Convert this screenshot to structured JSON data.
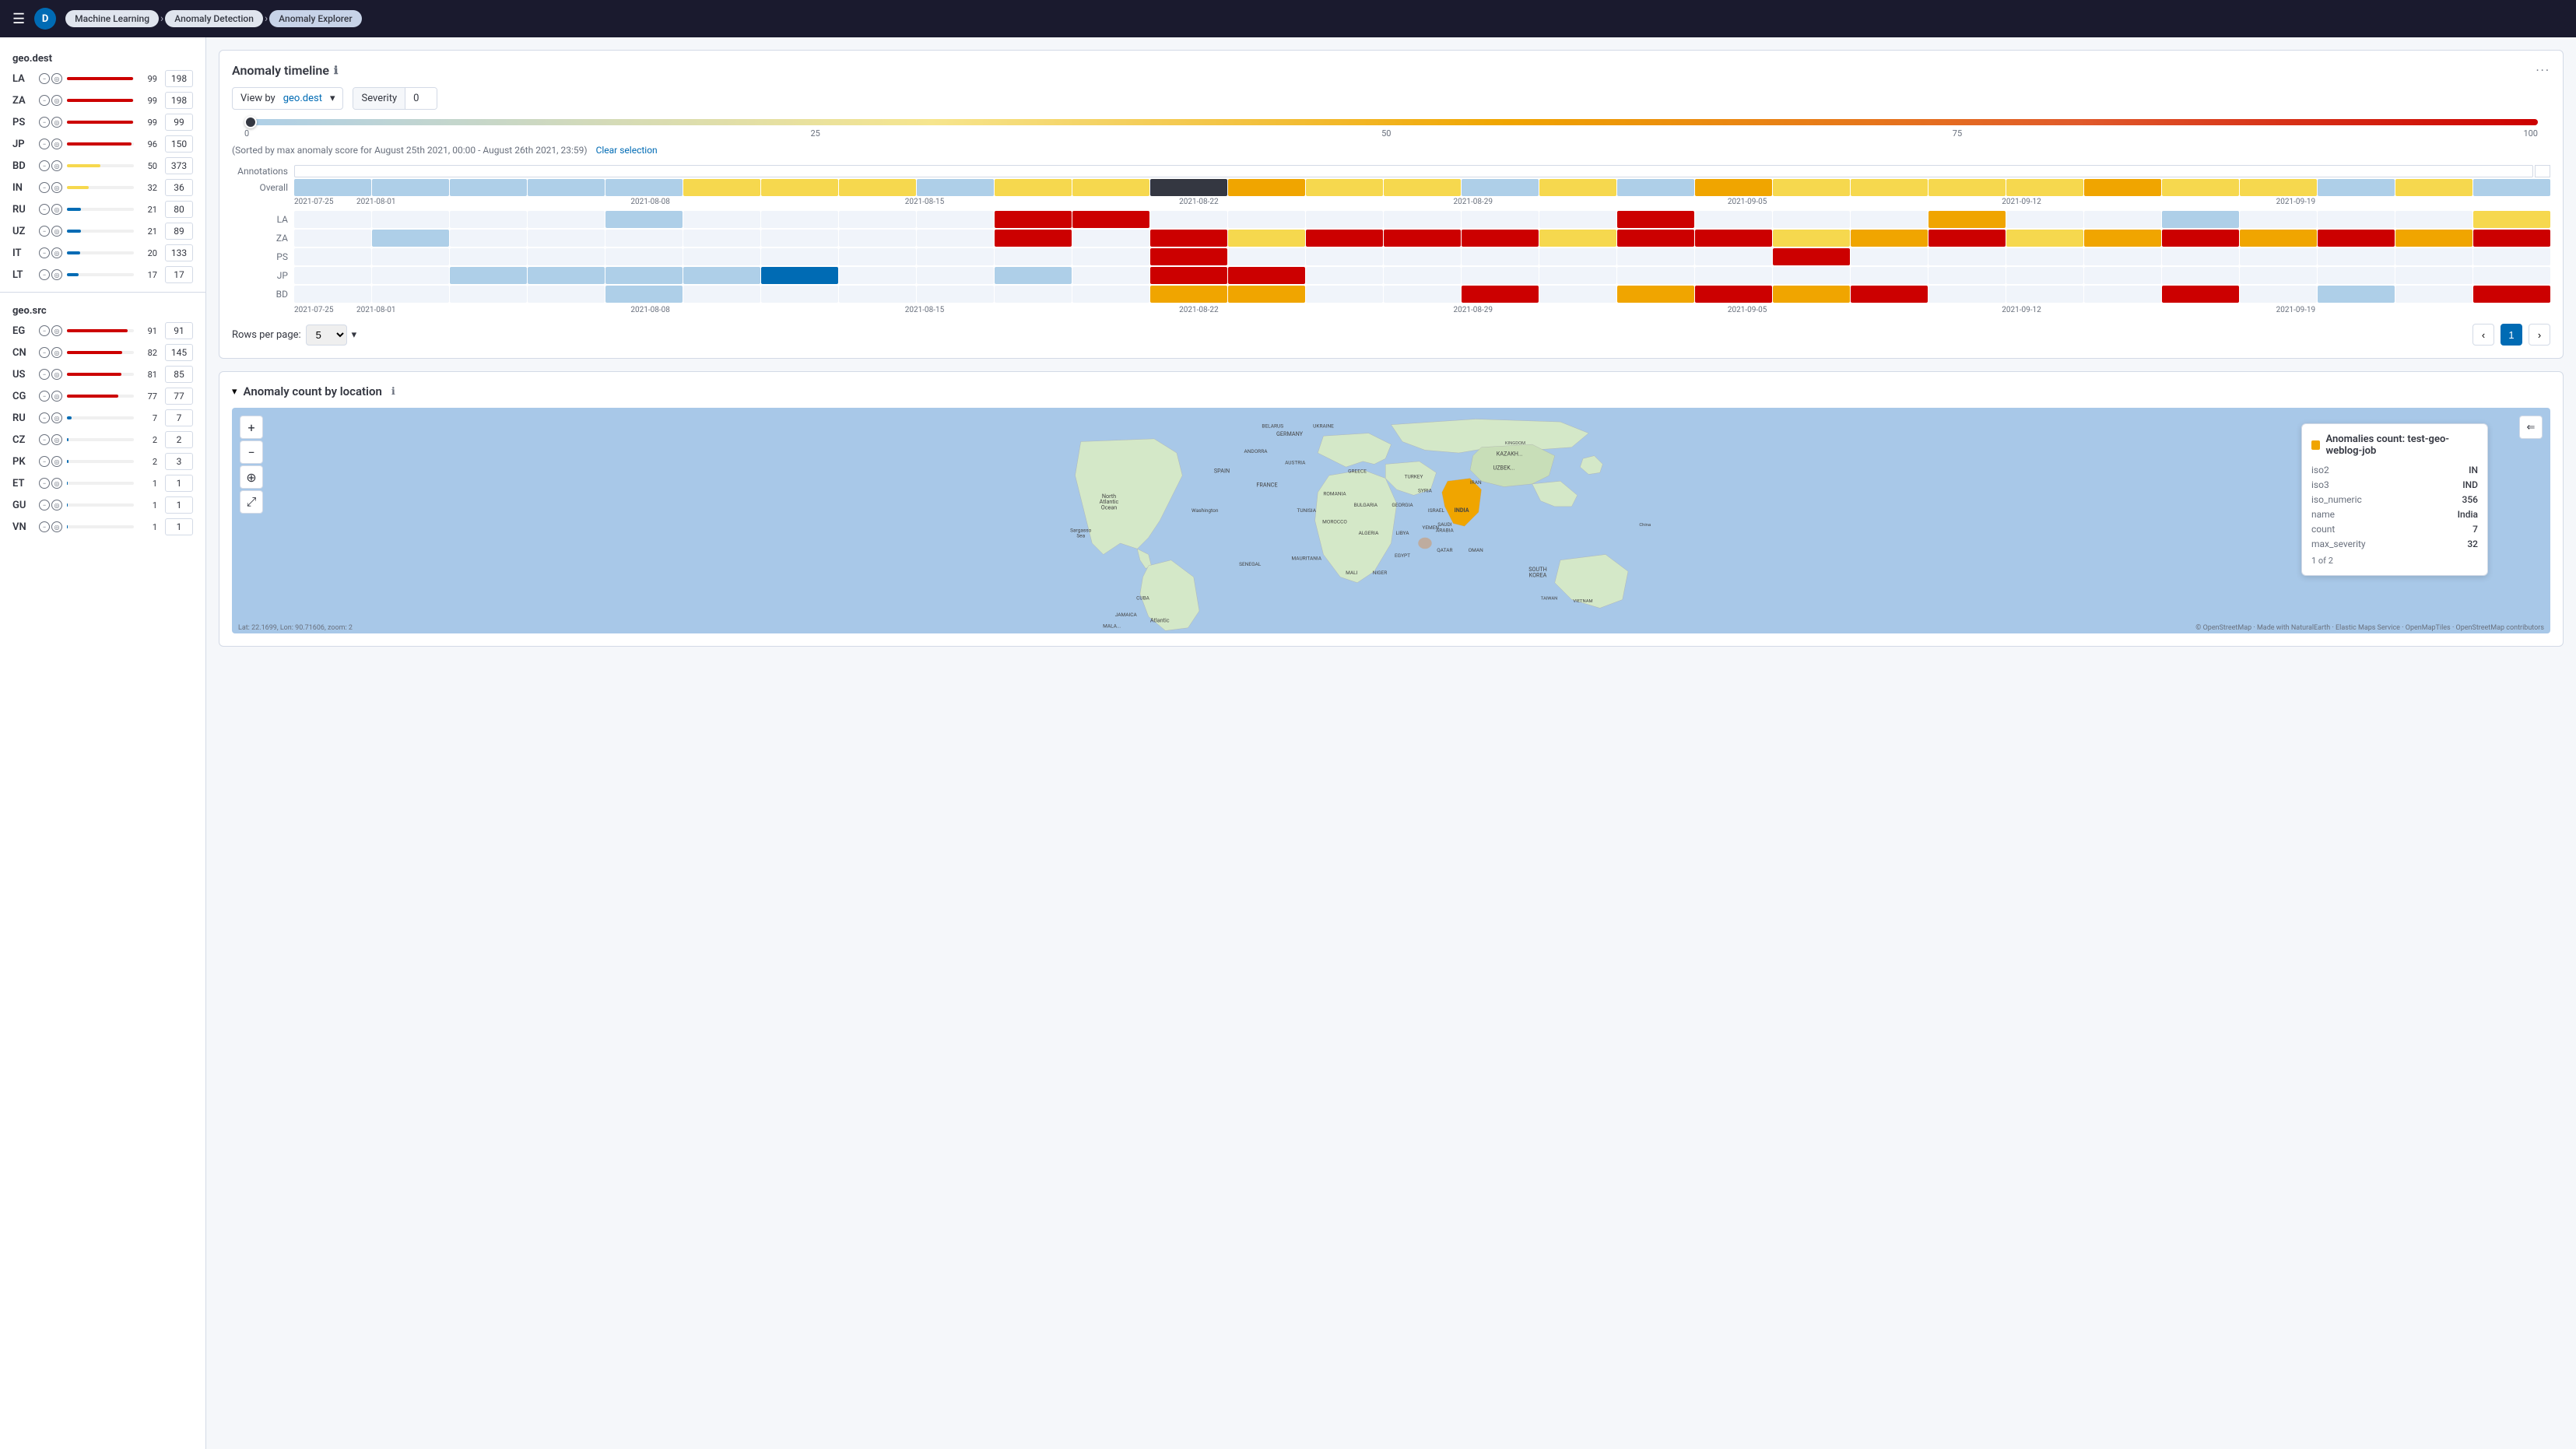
{
  "nav": {
    "avatar_label": "D",
    "breadcrumbs": [
      {
        "label": "Machine Learning",
        "active": false
      },
      {
        "label": "Anomaly Detection",
        "active": false
      },
      {
        "label": "Anomaly Explorer",
        "active": true
      }
    ]
  },
  "sidebar": {
    "geo_dest_title": "geo.dest",
    "geo_src_title": "geo.src",
    "dest_items": [
      {
        "label": "LA",
        "score": 99,
        "count": 198,
        "bar_pct": 99,
        "bar_color": "bar-red"
      },
      {
        "label": "ZA",
        "score": 99,
        "count": 198,
        "bar_pct": 99,
        "bar_color": "bar-red"
      },
      {
        "label": "PS",
        "score": 99,
        "count": 99,
        "bar_pct": 99,
        "bar_color": "bar-red"
      },
      {
        "label": "JP",
        "score": 96,
        "count": 150,
        "bar_pct": 96,
        "bar_color": "bar-red"
      },
      {
        "label": "BD",
        "score": 50,
        "count": 373,
        "bar_pct": 50,
        "bar_color": "bar-yellow"
      },
      {
        "label": "IN",
        "score": 32,
        "count": 36,
        "bar_pct": 32,
        "bar_color": "bar-yellow"
      },
      {
        "label": "RU",
        "score": 21,
        "count": 80,
        "bar_pct": 21,
        "bar_color": "bar-blue"
      },
      {
        "label": "UZ",
        "score": 21,
        "count": 89,
        "bar_pct": 21,
        "bar_color": "bar-blue"
      },
      {
        "label": "IT",
        "score": 20,
        "count": 133,
        "bar_pct": 20,
        "bar_color": "bar-blue"
      },
      {
        "label": "LT",
        "score": 17,
        "count": 17,
        "bar_pct": 17,
        "bar_color": "bar-blue"
      }
    ],
    "src_items": [
      {
        "label": "EG",
        "score": 91,
        "count": 91,
        "bar_pct": 91,
        "bar_color": "bar-red"
      },
      {
        "label": "CN",
        "score": 82,
        "count": 145,
        "bar_pct": 82,
        "bar_color": "bar-red"
      },
      {
        "label": "US",
        "score": 81,
        "count": 85,
        "bar_pct": 81,
        "bar_color": "bar-red"
      },
      {
        "label": "CG",
        "score": 77,
        "count": 77,
        "bar_pct": 77,
        "bar_color": "bar-red"
      },
      {
        "label": "RU",
        "score": 7,
        "count": 7,
        "bar_pct": 7,
        "bar_color": "bar-blue"
      },
      {
        "label": "CZ",
        "score": 2,
        "count": 2,
        "bar_pct": 2,
        "bar_color": "bar-blue"
      },
      {
        "label": "PK",
        "score": 2,
        "count": 3,
        "bar_pct": 2,
        "bar_color": "bar-blue"
      },
      {
        "label": "ET",
        "score": 1,
        "count": 1,
        "bar_pct": 1,
        "bar_color": "bar-blue"
      },
      {
        "label": "GU",
        "score": 1,
        "count": 1,
        "bar_pct": 1,
        "bar_color": "bar-blue"
      },
      {
        "label": "VN",
        "score": 1,
        "count": 1,
        "bar_pct": 1,
        "bar_color": "bar-blue"
      }
    ]
  },
  "timeline": {
    "title": "Anomaly timeline",
    "view_by_label": "View by",
    "view_by_value": "geo.dest",
    "severity_label": "Severity",
    "severity_value": "0",
    "slider_min": "0",
    "slider_max": "100",
    "slider_marks": [
      "0",
      "25",
      "50",
      "75",
      "100"
    ],
    "sort_text": "(Sorted by max anomaly score for August 25th 2021, 00:00 - August 26th 2021, 23:59)",
    "clear_selection": "Clear selection",
    "annotations_label": "Annotations",
    "overall_label": "Overall",
    "row_labels": [
      "LA",
      "ZA",
      "PS",
      "JP",
      "BD"
    ],
    "axis_dates": [
      "2021-07-25",
      "2021-08-01",
      "2021-08-08",
      "2021-08-15",
      "2021-08-22",
      "2021-08-29",
      "2021-09-05",
      "2021-09-12",
      "2021-09-19"
    ],
    "rows_per_page_label": "Rows per page:",
    "rows_per_page_value": "5",
    "page_number": "1"
  },
  "map": {
    "title": "Anomaly count by location",
    "tooltip": {
      "title": "Anomalies count: test-geo-weblog-job",
      "rows": [
        {
          "key": "iso2",
          "value": "IN"
        },
        {
          "key": "iso3",
          "value": "IND"
        },
        {
          "key": "iso_numeric",
          "value": "356"
        },
        {
          "key": "name",
          "value": "India"
        },
        {
          "key": "count",
          "value": "7"
        },
        {
          "key": "max_severity",
          "value": "32"
        }
      ],
      "footer": "1 of 2"
    },
    "attribution": "© OpenStreetMap contributors",
    "coords": "Lat: 22.1699, Lon: 90.71606, zoom: 2"
  }
}
